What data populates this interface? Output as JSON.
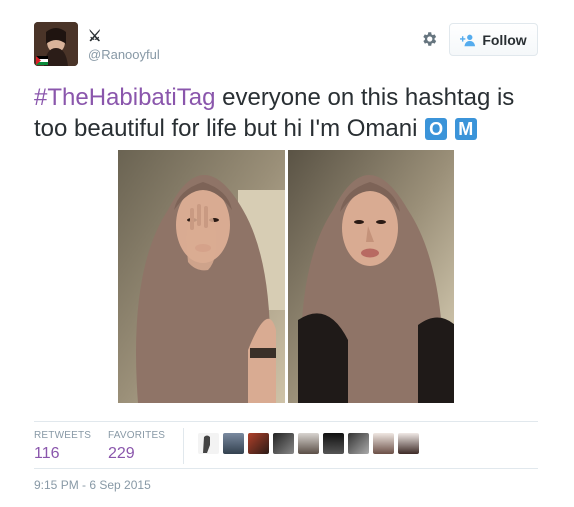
{
  "user": {
    "display_name": "⚔",
    "handle": "@Ranooyful",
    "avatar_icon": "profile-photo"
  },
  "actions": {
    "settings_icon": "gear-icon",
    "follow_label": "Follow"
  },
  "tweet": {
    "hashtag": "#TheHabibatiTag",
    "body": " everyone on this hashtag is too beautiful for life but hi I'm Omani ",
    "badge_o": "O",
    "badge_m": "M"
  },
  "media": {
    "photos": [
      "photo-left",
      "photo-right"
    ]
  },
  "stats": {
    "retweets_label": "RETWEETS",
    "retweets_value": "116",
    "favorites_label": "FAVORITES",
    "favorites_value": "229"
  },
  "favorited_by_count_shown": 10,
  "timestamp": "9:15 PM - 6 Sep 2015",
  "colors": {
    "hashtag": "#8a56ac",
    "badge": "#3b94d9",
    "muted": "#8899a6",
    "border": "#e1e8ed"
  }
}
